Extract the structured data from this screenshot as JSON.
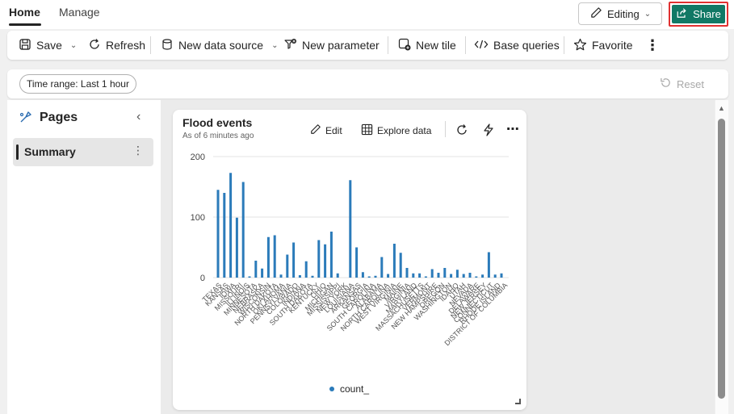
{
  "top_tabs": {
    "home": "Home",
    "manage": "Manage"
  },
  "header": {
    "editing_label": "Editing",
    "share_label": "Share"
  },
  "toolbar": {
    "save": "Save",
    "refresh": "Refresh",
    "new_data_source": "New data source",
    "new_parameter": "New parameter",
    "new_tile": "New tile",
    "base_queries": "Base queries",
    "favorite": "Favorite"
  },
  "timebar": {
    "time_range": "Time range: Last 1 hour",
    "reset": "Reset"
  },
  "pages_panel": {
    "title": "Pages",
    "items": [
      {
        "label": "Summary"
      }
    ]
  },
  "tile": {
    "title": "Flood events",
    "subtitle": "As of 6 minutes ago",
    "edit": "Edit",
    "explore": "Explore data"
  },
  "colors": {
    "accent": "#117865",
    "share_border": "#e03131",
    "bar": "#2b7bba"
  },
  "icons": [
    "pencil-icon",
    "share-icon",
    "save-icon",
    "refresh-icon",
    "database-icon",
    "filter-plus-icon",
    "new-tile-icon",
    "code-icon",
    "star-icon",
    "more-vertical-icon",
    "reset-icon",
    "pages-icon",
    "chevron-left-icon",
    "grid-icon",
    "refresh-icon",
    "lightning-icon",
    "more-horizontal-icon"
  ],
  "chart_data": {
    "type": "bar",
    "ylim": [
      0,
      200
    ],
    "yticks": [
      0,
      100,
      200
    ],
    "legend_position": "bottom",
    "series": [
      {
        "name": "count_",
        "values": [
          145,
          140,
          173,
          99,
          158,
          2,
          28,
          15,
          67,
          70,
          5,
          38,
          58,
          4,
          27,
          3,
          62,
          55,
          76,
          7,
          0,
          161,
          50,
          9,
          2,
          3,
          34,
          6,
          56,
          41,
          16,
          7,
          7,
          2,
          14,
          8,
          16,
          6,
          13,
          6,
          8,
          2,
          5,
          42,
          5,
          7
        ]
      }
    ],
    "visible_x_labels": [
      "TEXAS",
      "KANSAS",
      "IOWA",
      "MISSOURI",
      "ILLINOIS",
      "MINNESOTA",
      "NEBRASKA",
      "WISCONSIN",
      "NORTH DAKOTA",
      "OKLAHOMA",
      "PENNSYLVANIA",
      "COLORADO",
      "INDIANA",
      "SOUTH DAKOTA",
      "KENTUCKY",
      "OHIO",
      "MICHIGAN",
      "MISSISSIPPI",
      "NEW YORK",
      "LOUISIANA",
      "ARKANSAS",
      "GEORGIA",
      "SOUTH CAROLINA",
      "ALABAMA",
      "NORTH CAROLINA",
      "WEST VIRGINIA",
      "MAINE",
      "VIRGINIA",
      "MARYLAND",
      "MASSACHUSETTS",
      "VERMONT",
      "NEW HAMPSHIRE",
      "OREGON",
      "WASHINGTON",
      "IDAHO",
      "UTAH",
      "NEVADA",
      "DELAWARE",
      "NEW JERSEY",
      "CONNECTICUT",
      "RHODE ISLAND",
      "DISTRICT OF COLUMBIA"
    ]
  }
}
